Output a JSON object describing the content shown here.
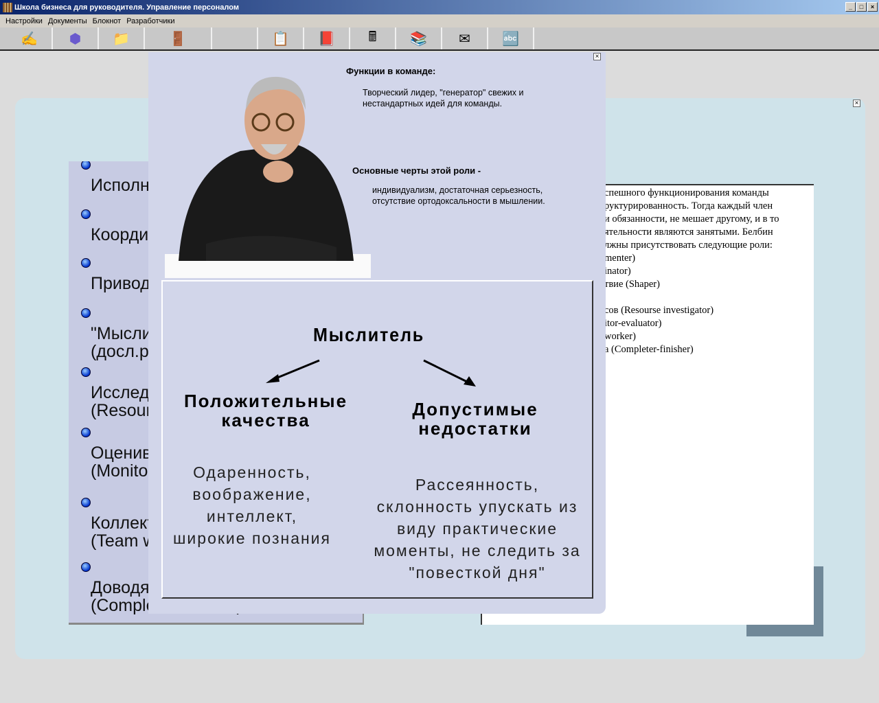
{
  "window": {
    "title": "Школа бизнеса для руководителя. Управление персоналом"
  },
  "menu": [
    "Настройки",
    "Документы",
    "Блокнот",
    "Разработчики"
  ],
  "toolbar": [
    {
      "icon": "signature-icon",
      "glyph": "✍"
    },
    {
      "icon": "cubes-icon",
      "glyph": "⬢"
    },
    {
      "icon": "folders-icon",
      "glyph": "📁"
    },
    {
      "icon": "exit-door-icon",
      "glyph": "🚪"
    },
    {
      "icon": "blank",
      "glyph": ""
    },
    {
      "icon": "clipboard-icon",
      "glyph": "📋"
    },
    {
      "icon": "book-icon",
      "glyph": "📕"
    },
    {
      "icon": "calculator-icon",
      "glyph": "🖩"
    },
    {
      "icon": "library-books-icon",
      "glyph": "📚"
    },
    {
      "icon": "envelope-icon",
      "glyph": "✉"
    },
    {
      "icon": "abc-icon",
      "glyph": "🔤"
    }
  ],
  "roles_list": [
    {
      "line1": "Исполнитель"
    },
    {
      "line1": "Координатор"
    },
    {
      "line1": "Приводящий в движение"
    },
    {
      "line1": "\"Мыслитель\"",
      "line2": "(досл.plant)"
    },
    {
      "line1": "Исследователь",
      "line2": "(Resourse investigator)"
    },
    {
      "line1": "Оценивающий",
      "line2": "(Monitor-evaluator)"
    },
    {
      "line1": "Коллективист",
      "line2": "(Team worker)"
    },
    {
      "line1": "Доводящий",
      "line2": "(Completer-finisher)"
    }
  ],
  "right_text": [
    "спешного   функционирования  команды",
    "руктурированность.  Тогда  каждый  член",
    "и обязанности, не мешает другому, и в то",
    "ятельности   являются занятыми. Белбин",
    "лжны присутствовать следующие роли:",
    "menter)",
    "inator)",
    "твие (Shaper)",
    "",
    "сов (Resourse investigator)",
    "itor-evaluator)",
    "worker)",
    "а (Completer-finisher)"
  ],
  "popup": {
    "functions_heading": "Функции в команде:",
    "functions_text": "Творческий лидер, \"генератор\" свежих и нестандартных идей для команды.",
    "traits_heading": "Основные черты этой роли -",
    "traits_text": "индивидуализм, достаточная серьезность, отсутствие ортодоксальности в мышлении.",
    "role_title": "Мыслитель",
    "positive_heading": "Положительные качества",
    "positive_text": "Одаренность, воображение, интеллект, широкие познания",
    "negative_heading": "Допустимые недостатки",
    "negative_text": "Рассеянность, склонность упускать из виду практические моменты, не следить за \"повесткой дня\""
  }
}
